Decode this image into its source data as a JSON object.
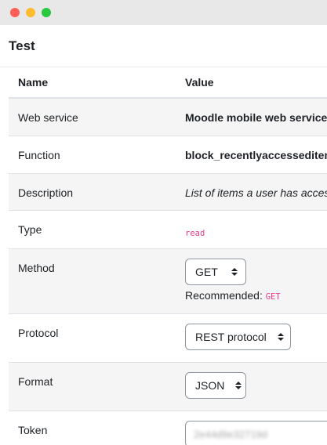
{
  "window": {
    "title": "Test"
  },
  "table": {
    "headers": {
      "name": "Name",
      "value": "Value"
    },
    "rows": {
      "web_service": {
        "label": "Web service",
        "value": "Moodle mobile web service"
      },
      "function": {
        "label": "Function",
        "value": "block_recentlyaccesseditems_get_recent_items"
      },
      "description": {
        "label": "Description",
        "value": "List of items a user has accessed most recently."
      },
      "type": {
        "label": "Type",
        "value": "read"
      },
      "method": {
        "label": "Method",
        "selected": "GET",
        "recommended_label": "Recommended:",
        "recommended_value": "GET"
      },
      "protocol": {
        "label": "Protocol",
        "selected": "REST protocol"
      },
      "format": {
        "label": "Format",
        "selected": "JSON"
      },
      "token": {
        "label": "Token",
        "value": "2e44d9e32719d"
      }
    }
  },
  "colors": {
    "code_pink": "#e83e8c",
    "stripe": "#f5f5f5",
    "border": "#dee2e6"
  }
}
